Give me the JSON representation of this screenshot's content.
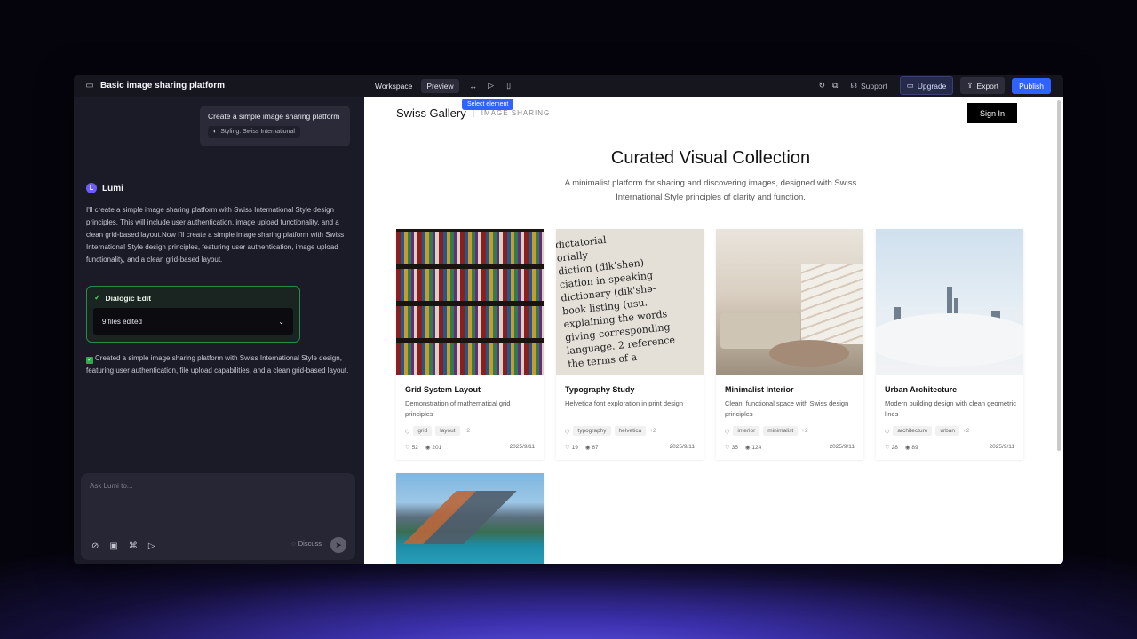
{
  "app": {
    "project_title": "Basic image sharing platform",
    "tabs": [
      "Workspace",
      "Preview"
    ],
    "tooltip": "Select element",
    "support_label": "Support",
    "upgrade_label": "Upgrade",
    "export_label": "Export",
    "publish_label": "Publish",
    "accent": "#2f62ff"
  },
  "chat": {
    "user_message": "Create a simple image sharing platform",
    "styling_chip": "Styling: Swiss International",
    "assistant_name": "Lumi",
    "assistant_text": "I'll create a simple image sharing platform with Swiss International Style design principles. This will include user authentication, image upload functionality, and a clean grid-based layout.Now I'll create a simple image sharing platform with Swiss International Style design principles, featuring user authentication, image upload functionality, and a clean grid-based layout.",
    "dialogic_title": "Dialogic Edit",
    "files_edited": "9 files edited",
    "done_text": "Created a simple image sharing platform with Swiss International Style design, featuring user authentication, file upload capabilities, and a clean grid-based layout.",
    "input_placeholder": "Ask Lumi to...",
    "discuss_label": "Discuss"
  },
  "site": {
    "name": "Swiss Gallery",
    "subtitle": "IMAGE SHARING",
    "signin_label": "Sign In",
    "hero_title": "Curated Visual Collection",
    "hero_subtitle": "A minimalist platform for sharing and discovering images, designed with Swiss International Style principles of clarity and function."
  },
  "cards": [
    {
      "title": "Grid System Layout",
      "desc": "Demonstration of mathematical grid principles",
      "tags": [
        "grid",
        "layout"
      ],
      "more": "+2",
      "likes": "52",
      "views": "201",
      "date": "2025/9/11"
    },
    {
      "title": "Typography Study",
      "desc": "Helvetica font exploration in print design",
      "tags": [
        "typography",
        "helvetica"
      ],
      "more": "+2",
      "likes": "19",
      "views": "67",
      "date": "2025/9/11"
    },
    {
      "title": "Minimalist Interior",
      "desc": "Clean, functional space with Swiss design principles",
      "tags": [
        "interior",
        "minimalist"
      ],
      "more": "+2",
      "likes": "35",
      "views": "124",
      "date": "2025/9/11"
    },
    {
      "title": "Urban Architecture",
      "desc": "Modern building design with clean geometric lines",
      "tags": [
        "architecture",
        "urban"
      ],
      "more": "+2",
      "likes": "28",
      "views": "89",
      "date": "2025/9/11"
    }
  ]
}
